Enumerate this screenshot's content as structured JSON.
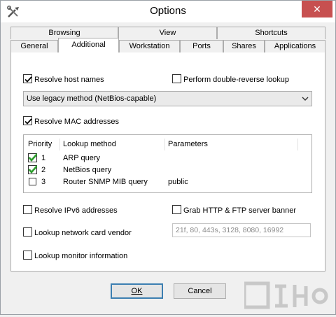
{
  "window": {
    "title": "Options"
  },
  "tabs": {
    "top_row": [
      "Browsing",
      "View",
      "Shortcuts"
    ],
    "bottom_row": [
      "General",
      "Additional",
      "Workstation",
      "Ports",
      "Shares",
      "Applications"
    ],
    "active": "Additional"
  },
  "options": {
    "resolve_host_names": {
      "label": "Resolve host names",
      "checked": true
    },
    "double_reverse": {
      "label": "Perform double-reverse lookup",
      "checked": false
    },
    "method_select": {
      "value": "Use legacy method (NetBios-capable)"
    },
    "resolve_mac": {
      "label": "Resolve MAC addresses",
      "checked": true
    },
    "resolve_ipv6": {
      "label": "Resolve IPv6 addresses",
      "checked": false
    },
    "grab_banner": {
      "label": "Grab HTTP & FTP server banner",
      "checked": false
    },
    "lookup_vendor": {
      "label": "Lookup network card vendor",
      "checked": false
    },
    "ports_field": {
      "value": "21f, 80, 443s, 3128, 8080, 16992"
    },
    "lookup_monitor": {
      "label": "Lookup monitor information",
      "checked": false
    }
  },
  "mac_table": {
    "headers": [
      "Priority",
      "Lookup method",
      "Parameters"
    ],
    "rows": [
      {
        "priority": "1",
        "method": "ARP query",
        "params": "",
        "checked": true
      },
      {
        "priority": "2",
        "method": "NetBios query",
        "params": "",
        "checked": true
      },
      {
        "priority": "3",
        "method": "Router SNMP MIB query",
        "params": "public",
        "checked": false
      }
    ]
  },
  "buttons": {
    "ok": "OK",
    "cancel": "Cancel"
  },
  "colors": {
    "close": "#c75050",
    "check_green": "#2e9e2e",
    "default_border": "#3c7fb1"
  }
}
